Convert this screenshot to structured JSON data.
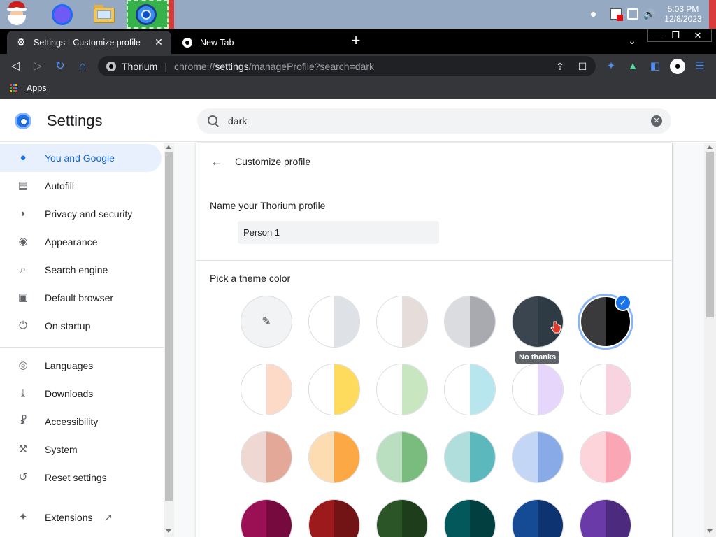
{
  "taskbar": {
    "time": "5:03 PM",
    "date": "12/8/2023"
  },
  "tabs": [
    {
      "label": "Settings - Customize profile",
      "active": true
    },
    {
      "label": "New Tab",
      "active": false
    }
  ],
  "omnibox": {
    "site": "Thorium",
    "url_scheme": "chrome://",
    "url_host": "settings",
    "url_path": "/manageProfile?search=dark"
  },
  "bookmarks": {
    "apps_label": "Apps"
  },
  "settings": {
    "title": "Settings",
    "search_value": "dark"
  },
  "sidebar": {
    "items": [
      {
        "label": "You and Google",
        "icon": "person-icon",
        "glyph": "●"
      },
      {
        "label": "Autofill",
        "icon": "clipboard-icon",
        "glyph": "▤"
      },
      {
        "label": "Privacy and security",
        "icon": "shield-icon",
        "glyph": "◗"
      },
      {
        "label": "Appearance",
        "icon": "palette-icon",
        "glyph": "◉"
      },
      {
        "label": "Search engine",
        "icon": "search-icon",
        "glyph": "⌕"
      },
      {
        "label": "Default browser",
        "icon": "browser-window-icon",
        "glyph": "▣"
      },
      {
        "label": "On startup",
        "icon": "power-icon",
        "glyph": "⏻"
      },
      {
        "label": "Languages",
        "icon": "globe-icon",
        "glyph": "◎"
      },
      {
        "label": "Downloads",
        "icon": "download-icon",
        "glyph": "⤓"
      },
      {
        "label": "Accessibility",
        "icon": "accessibility-icon",
        "glyph": "☧"
      },
      {
        "label": "System",
        "icon": "wrench-icon",
        "glyph": "⚒"
      },
      {
        "label": "Reset settings",
        "icon": "reset-history-icon",
        "glyph": "↺"
      },
      {
        "label": "Extensions",
        "icon": "puzzle-icon",
        "glyph": "✦"
      }
    ]
  },
  "profile": {
    "page_title": "Customize profile",
    "name_label": "Name your Thorium profile",
    "name_value": "Person 1",
    "theme_label": "Pick a theme color",
    "tooltip": "No thanks",
    "swatches": [
      {
        "row": 0,
        "left": "#f1f3f4",
        "right": "#f1f3f4",
        "picker": true
      },
      {
        "row": 0,
        "left": "#ffffff",
        "right": "#dee1e6"
      },
      {
        "row": 0,
        "left": "#ffffff",
        "right": "#e6dcd9"
      },
      {
        "row": 0,
        "left": "#dadce0",
        "right": "#a8aab0"
      },
      {
        "row": 0,
        "left": "#3a454f",
        "right": "#2e3a44"
      },
      {
        "row": 0,
        "left": "#3a3a3c",
        "right": "#000000",
        "selected": true
      },
      {
        "row": 1,
        "left": "#ffffff",
        "right": "#fdd9c7"
      },
      {
        "row": 1,
        "left": "#ffffff",
        "right": "#fedb5c"
      },
      {
        "row": 1,
        "left": "#ffffff",
        "right": "#c8e6c0"
      },
      {
        "row": 1,
        "left": "#ffffff",
        "right": "#b7e6ef"
      },
      {
        "row": 1,
        "left": "#ffffff",
        "right": "#e7d6fc"
      },
      {
        "row": 1,
        "left": "#ffffff",
        "right": "#f8d3e0"
      },
      {
        "row": 2,
        "left": "#f0d8d2",
        "right": "#e3a898"
      },
      {
        "row": 2,
        "left": "#fddcb2",
        "right": "#fca945"
      },
      {
        "row": 2,
        "left": "#b9dfc0",
        "right": "#79bc7e"
      },
      {
        "row": 2,
        "left": "#afdedc",
        "right": "#5bb8bd"
      },
      {
        "row": 2,
        "left": "#c4d6f5",
        "right": "#88aae6"
      },
      {
        "row": 2,
        "left": "#fdd4da",
        "right": "#fba6b5"
      },
      {
        "row": 3,
        "left": "#9b1055",
        "right": "#760a3f"
      },
      {
        "row": 3,
        "left": "#9c1a1c",
        "right": "#721315"
      },
      {
        "row": 3,
        "left": "#2b5526",
        "right": "#1e3d1b"
      },
      {
        "row": 3,
        "left": "#02585a",
        "right": "#013f41"
      },
      {
        "row": 3,
        "left": "#154a94",
        "right": "#0d3370"
      },
      {
        "row": 3,
        "left": "#6a3aa8",
        "right": "#4c2a7d"
      }
    ]
  },
  "colors": {
    "accent": "#1a73e8",
    "active_nav_bg": "#e8f0fe"
  }
}
